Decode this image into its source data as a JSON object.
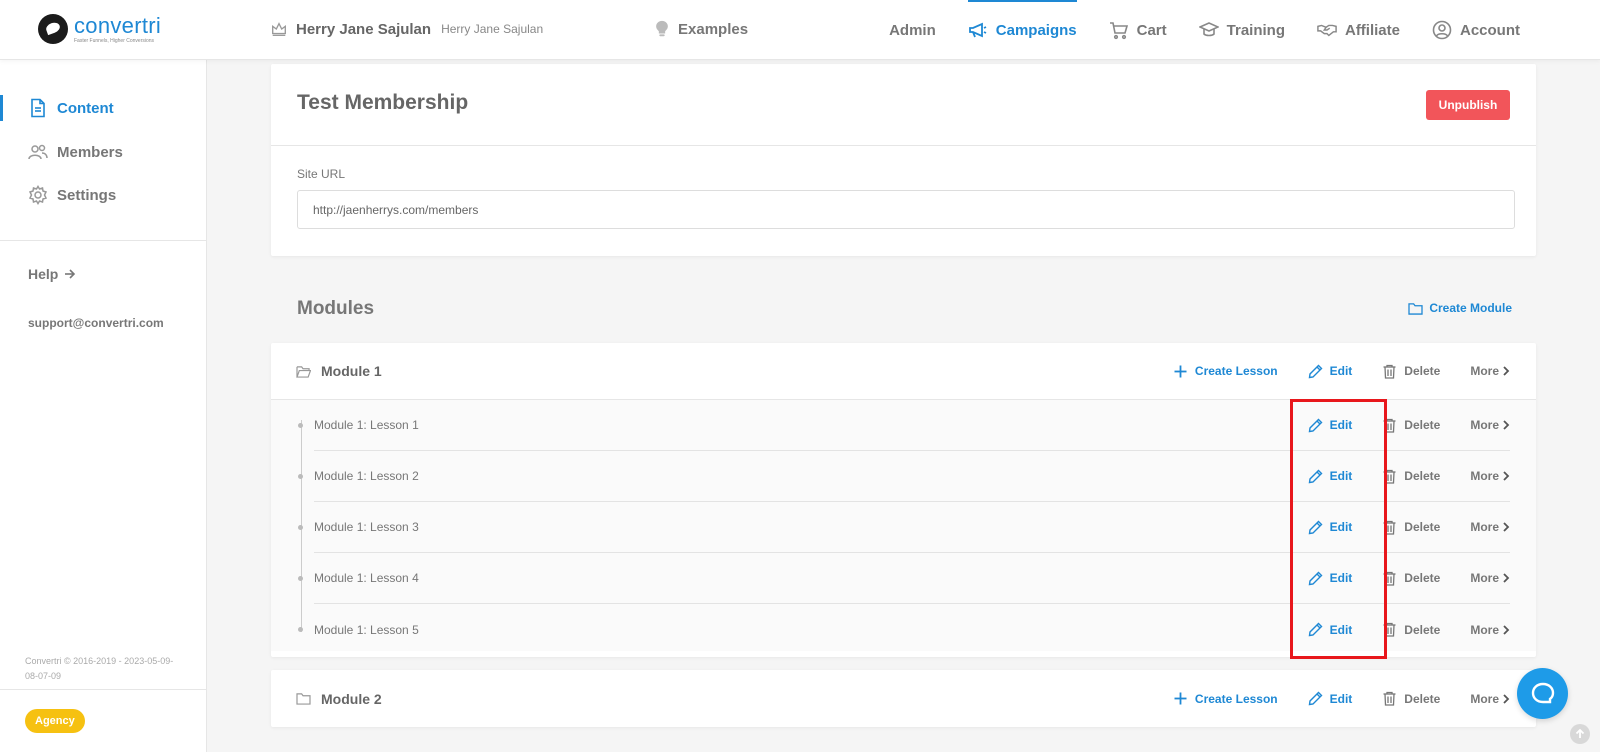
{
  "brand": {
    "name": "convertri",
    "tagline": "Faster Funnels, Higher Conversions"
  },
  "user": {
    "name": "Herry Jane Sajulan",
    "sub": "Herry Jane Sajulan"
  },
  "examples_label": "Examples",
  "nav": [
    {
      "label": "Admin",
      "icon": "none"
    },
    {
      "label": "Campaigns",
      "icon": "megaphone-icon",
      "active": true
    },
    {
      "label": "Cart",
      "icon": "cart-icon"
    },
    {
      "label": "Training",
      "icon": "graduation-cap-icon"
    },
    {
      "label": "Affiliate",
      "icon": "handshake-icon"
    },
    {
      "label": "Account",
      "icon": "user-circle-icon"
    }
  ],
  "sidebar": {
    "items": [
      {
        "label": "Content",
        "icon": "document-icon",
        "active": true
      },
      {
        "label": "Members",
        "icon": "users-icon"
      },
      {
        "label": "Settings",
        "icon": "gear-icon"
      }
    ],
    "help": "Help",
    "support": "support@convertri.com",
    "copyright": "Convertri © 2016-2019 - 2023-05-09-08-07-09",
    "badge": "Agency"
  },
  "membership": {
    "title": "Test Membership",
    "unpublish": "Unpublish",
    "site_url_label": "Site URL",
    "site_url": "http://jaenherrys.com/members"
  },
  "modules_title": "Modules",
  "create_module": "Create Module",
  "actions": {
    "create_lesson": "Create Lesson",
    "edit": "Edit",
    "delete": "Delete",
    "more": "More"
  },
  "modules": [
    {
      "name": "Module 1",
      "lessons": [
        "Module 1: Lesson 1",
        "Module 1: Lesson 2",
        "Module 1: Lesson 3",
        "Module 1: Lesson 4",
        "Module 1: Lesson 5"
      ]
    },
    {
      "name": "Module 2",
      "lessons": []
    }
  ],
  "colors": {
    "accent": "#1e88d4",
    "danger": "#f2555a",
    "highlight": "#e8171c",
    "badge": "#f6c111"
  }
}
